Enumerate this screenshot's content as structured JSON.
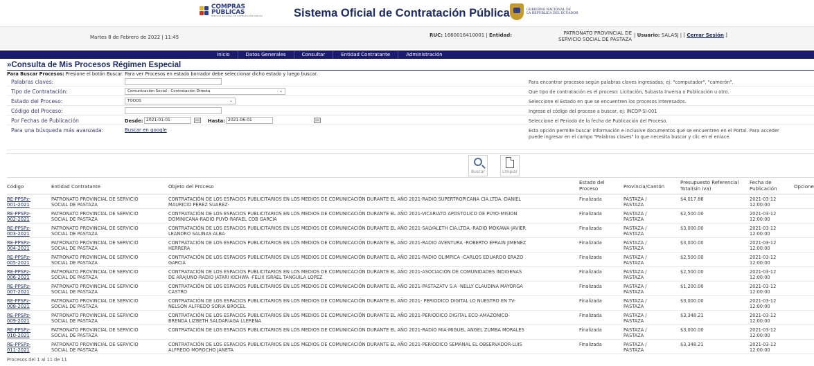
{
  "header": {
    "logo_text_1": "COMPRAS",
    "logo_text_2": "PÚBLICAS",
    "logo_sub": "SERVICIO NACIONAL DE CONTRATACIÓN PÚBLICA",
    "title": "Sistema Oficial de Contratación Pública",
    "gov_line_1": "GOBIERNO NACIONAL DE",
    "gov_line_2": "LA REPUBLICA DEL ECUADOR"
  },
  "infobar": {
    "date": "Martes 8 de Febrero de 2022 | 11:45",
    "ruc_label": "RUC:",
    "ruc_value": "1660016410001",
    "entity_label": "Entidad:",
    "entity_value": "PATRONATO PROVINCIAL DE SERVICIO SOCIAL DE PASTAZA",
    "user_label": "Usuario:",
    "user_value": "SALASJ",
    "logout": "Cerrar Sesión"
  },
  "nav": [
    "Inicio",
    "Datos Generales",
    "Consultar",
    "Entidad Contratante",
    "Administración"
  ],
  "page": {
    "title": "»Consulta de Mis Procesos Régimen Especial",
    "instruction_bold": "Para Buscar Procesos:",
    "instruction": " Presione el botón Buscar. Para ver Procesos en estado borrador debe seleccionar dicho estado y luego buscar."
  },
  "form": {
    "keywords": {
      "label": "Palabras claves:",
      "value": "",
      "help": "Para encontrar procesos según palabras claves ingresadas; ej: \"computador\", \"camerón\"."
    },
    "contract_type": {
      "label": "Tipo de Contratación:",
      "value": "Comunicación Social - Contratación Directa",
      "help": "Que tipo de contratación es el proceso: Licitación, Subasta Inversa o Publicación u otro."
    },
    "status": {
      "label": "Estado del Proceso:",
      "value": "TODOS",
      "help": "Seleccione el Estado en que se encuentren los procesos interesados."
    },
    "code": {
      "label": "Código del Proceso:",
      "value": "",
      "help": "Ingrese el código del proceso a buscar, ej: INCOP-SI-001"
    },
    "dates": {
      "label": "Por Fechas de Publicación",
      "from_label": "Desde:",
      "from_value": "2021-01-01",
      "to_label": "Hasta:",
      "to_value": "2021-06-01",
      "help": "Seleccione el Periodo de la fecha de Publicación del Proceso."
    },
    "advanced": {
      "label": "Para una búsqueda más avanzada:",
      "link": "Buscar en google",
      "help_1": "Esta opción permite buscar información e inclusive documentos que se encuentren en el Portal. Para acceder",
      "help_2": "puede ingresar en el campo \"Palabras claves\" lo que necesita buscar y clic en el enlace."
    }
  },
  "actions": {
    "search": "Buscar",
    "clear": "Limpiar"
  },
  "table": {
    "headers": {
      "code": "Código",
      "entity": "Entidad Contratante",
      "object": "Objeto del Proceso",
      "status_1": "Estado del",
      "status_2": "Proceso",
      "province": "Provincia/Cantón",
      "budget_1": "Presupuesto Referencial",
      "budget_2": "Total(sin iva)",
      "date_1": "Fecha de",
      "date_2": "Publicación",
      "options": "Opciones"
    },
    "rows": [
      {
        "code_1": "RE-PPSPz-",
        "code_2": "001-2021",
        "entity_1": "PATRONATO PROVINCIAL DE SERVICIO",
        "entity_2": "SOCIAL DE PASTAZA",
        "object_1": "CONTRATACIÓN DE LOS ESPACIOS PUBLICITARIOS EN LOS MEDIOS DE COMUNICACIÓN DURANTE EL AÑO 2021-RADIO SUPERTROPICANA CIA.LTDA.-DANIEL",
        "object_2": "MAURICIO PEREZ SUAREZ-",
        "status": "Finalizada",
        "province_1": "PASTAZA /",
        "province_2": "PASTAZA",
        "budget": "$4,017.86",
        "date_1": "2021-03-12",
        "date_2": "12:00:00"
      },
      {
        "code_1": "RE-PPSPz-",
        "code_2": "002-2021",
        "entity_1": "PATRONATO PROVINCIAL DE SERVICIO",
        "entity_2": "SOCIAL DE PASTAZA",
        "object_1": "CONTRATACIÓN DE LOS ESPACIOS PUBLICITARIOS EN LOS MEDIOS DE COMUNICACIÓN DURANTE EL AÑO 2021-VICARIATO APOSTOLICO DE PUYO-MISION",
        "object_2": "DOMINICANA-RADIO PUYO-RAFAEL COB GARCIA",
        "status": "Finalizada",
        "province_1": "PASTAZA /",
        "province_2": "PASTAZA",
        "budget": "$2,500.00",
        "date_1": "2021-03-12",
        "date_2": "12:00:00"
      },
      {
        "code_1": "RE-PPSPz-",
        "code_2": "003-2021",
        "entity_1": "PATRONATO PROVINCIAL DE SERVICIO",
        "entity_2": "SOCIAL DE PASTAZA",
        "object_1": "CONTRATACIÓN DE LOS ESPACIOS PUBLICITARIOS EN LOS MEDIOS DE COMUNICACIÓN DURANTE EL AÑO 2021-SALVALETH CIA.LTDA.-RADIO MOKAWA-JAVIER",
        "object_2": "LEANDRO SALINAS ALBA",
        "status": "Finalizada",
        "province_1": "PASTAZA /",
        "province_2": "PASTAZA",
        "budget": "$3,000.00",
        "date_1": "2021-03-12",
        "date_2": "12:00:00"
      },
      {
        "code_1": "RE-PPSPz-",
        "code_2": "004-2021",
        "entity_1": "PATRONATO PROVINCIAL DE SERVICIO",
        "entity_2": "SOCIAL DE PASTAZA",
        "object_1": "CONTRATACIÓN DE LOS ESPACIOS PUBLICITARIOS EN LOS MEDIOS DE COMUNICACIÓN DURANTE EL AÑO 2021-RADIO AVENTURA -ROBERTO EFRAIN JIMENEZ",
        "object_2": "HERRERA",
        "status": "Finalizada",
        "province_1": "PASTAZA /",
        "province_2": "PASTAZA",
        "budget": "$3,000.00",
        "date_1": "2021-03-12",
        "date_2": "12:00:00"
      },
      {
        "code_1": "RE-PPSPz-",
        "code_2": "005-2021",
        "entity_1": "PATRONATO PROVINCIAL DE SERVICIO",
        "entity_2": "SOCIAL DE PASTAZA",
        "object_1": "CONTRATACIÓN DE LOS ESPACIOS PUBLICITARIOS EN LOS MEDIOS DE COMUNICACIÓN DURANTE EL AÑO 2021-RADIO OLIMPICA -CARLOS EDUARDO ERAZO",
        "object_2": "GARCIA",
        "status": "Finalizada",
        "province_1": "PASTAZA /",
        "province_2": "PASTAZA",
        "budget": "$2,500.00",
        "date_1": "2021-03-12",
        "date_2": "12:00:00"
      },
      {
        "code_1": "RE-PPSPz-",
        "code_2": "006-2021",
        "entity_1": "PATRONATO PROVINCIAL DE SERVICIO",
        "entity_2": "SOCIAL DE PASTAZA",
        "object_1": "CONTRATACIÓN DE LOS ESPACIOS PUBLICITARIOS EN LOS MEDIOS DE COMUNICACIÓN DURANTE EL AÑO 2021-ASOCIACION DE COMUNIDADES INDIGENAS",
        "object_2": "DE ARAJUNO-RADIO JATARI KICHWA -FELIX ISRAEL TANGUILA LOPEZ",
        "status": "Finalizada",
        "province_1": "PASTAZA /",
        "province_2": "PASTAZA",
        "budget": "$2,500.00",
        "date_1": "2021-03-12",
        "date_2": "12:00:00"
      },
      {
        "code_1": "RE-PPSPz-",
        "code_2": "007-2021",
        "entity_1": "PATRONATO PROVINCIAL DE SERVICIO",
        "entity_2": "SOCIAL DE PASTAZA",
        "object_1": "CONTRATACIÓN DE LOS ESPACIOS PUBLICITARIOS EN LOS MEDIOS DE COMUNICACIÓN DURANTE EL AÑO 2021-PASTAZATV S.A -NELLY CLAUDINA MAYORGA",
        "object_2": "CASTRO",
        "status": "Finalizada",
        "province_1": "PASTAZA /",
        "province_2": "PASTAZA",
        "budget": "$1,200.00",
        "date_1": "2021-03-12",
        "date_2": "12:00:00"
      },
      {
        "code_1": "RE-PPSPz-",
        "code_2": "008-2021",
        "entity_1": "PATRONATO PROVINCIAL DE SERVICIO",
        "entity_2": "SOCIAL DE PASTAZA",
        "object_1": "CONTRATACIÓN DE LOS ESPACIOS PUBLICITARIOS EN LOS MEDIOS DE COMUNICACIÓN DURANTE EL AÑO 2021- PERIODICO DIGITAL LO NUESTRO EN TV-",
        "object_2": "NELSON ALFREDO SORIA BROCEL",
        "status": "Finalizada",
        "province_1": "PASTAZA /",
        "province_2": "PASTAZA",
        "budget": "$3,000.00",
        "date_1": "2021-03-12",
        "date_2": "12:00:00"
      },
      {
        "code_1": "RE-PPSPz-",
        "code_2": "009-2021",
        "entity_1": "PATRONATO PROVINCIAL DE SERVICIO",
        "entity_2": "SOCIAL DE PASTAZA",
        "object_1": "CONTRATACIÓN DE LOS ESPACIOS PUBLICITARIOS EN LOS MEDIOS DE COMUNICACIÓN DURANTE EL AÑO 2021-PERIODICO DIGITAL ECO-AMAZONICO-",
        "object_2": "BRENDA LIZBETH SALDARIAGA LLERENA",
        "status": "Finalizada",
        "province_1": "PASTAZA /",
        "province_2": "PASTAZA",
        "budget": "$3,348.21",
        "date_1": "2021-03-12",
        "date_2": "12:00:00"
      },
      {
        "code_1": "RE-PPSPz-",
        "code_2": "010-2021",
        "entity_1": "PATRONATO PROVINCIAL DE SERVICIO",
        "entity_2": "SOCIAL DE PASTAZA",
        "object_1": "CONTRATACIÓN DE LOS ESPACIOS PUBLICITARIOS EN LOS MEDIOS DE COMUNICACIÓN DURANTE EL AÑO 2021-RADIO MIA-MIGUEL ANGEL ZUMBA MORALES",
        "object_2": "",
        "status": "Finalizada",
        "province_1": "PASTAZA /",
        "province_2": "PASTAZA",
        "budget": "$3,000.00",
        "date_1": "2021-03-12",
        "date_2": "12:00:00"
      },
      {
        "code_1": "RE-PPSPz-",
        "code_2": "011-2021",
        "entity_1": "PATRONATO PROVINCIAL DE SERVICIO",
        "entity_2": "SOCIAL DE PASTAZA",
        "object_1": "CONTRATACIÓN DE LOS ESPACIOS PUBLICITARIOS EN LOS MEDIOS DE COMUNICACIÓN DURANTE EL AÑO 2021-PERIODICO SEMANAL EL OBSERVADOR-LUIS",
        "object_2": "ALFREDO MOROCHO JANETA",
        "status": "Finalizada",
        "province_1": "PASTAZA /",
        "province_2": "PASTAZA",
        "budget": "$3,348.21",
        "date_1": "2021-03-12",
        "date_2": "12:00:00"
      }
    ],
    "footer": "Procesos del 1 al 11 de 11"
  }
}
